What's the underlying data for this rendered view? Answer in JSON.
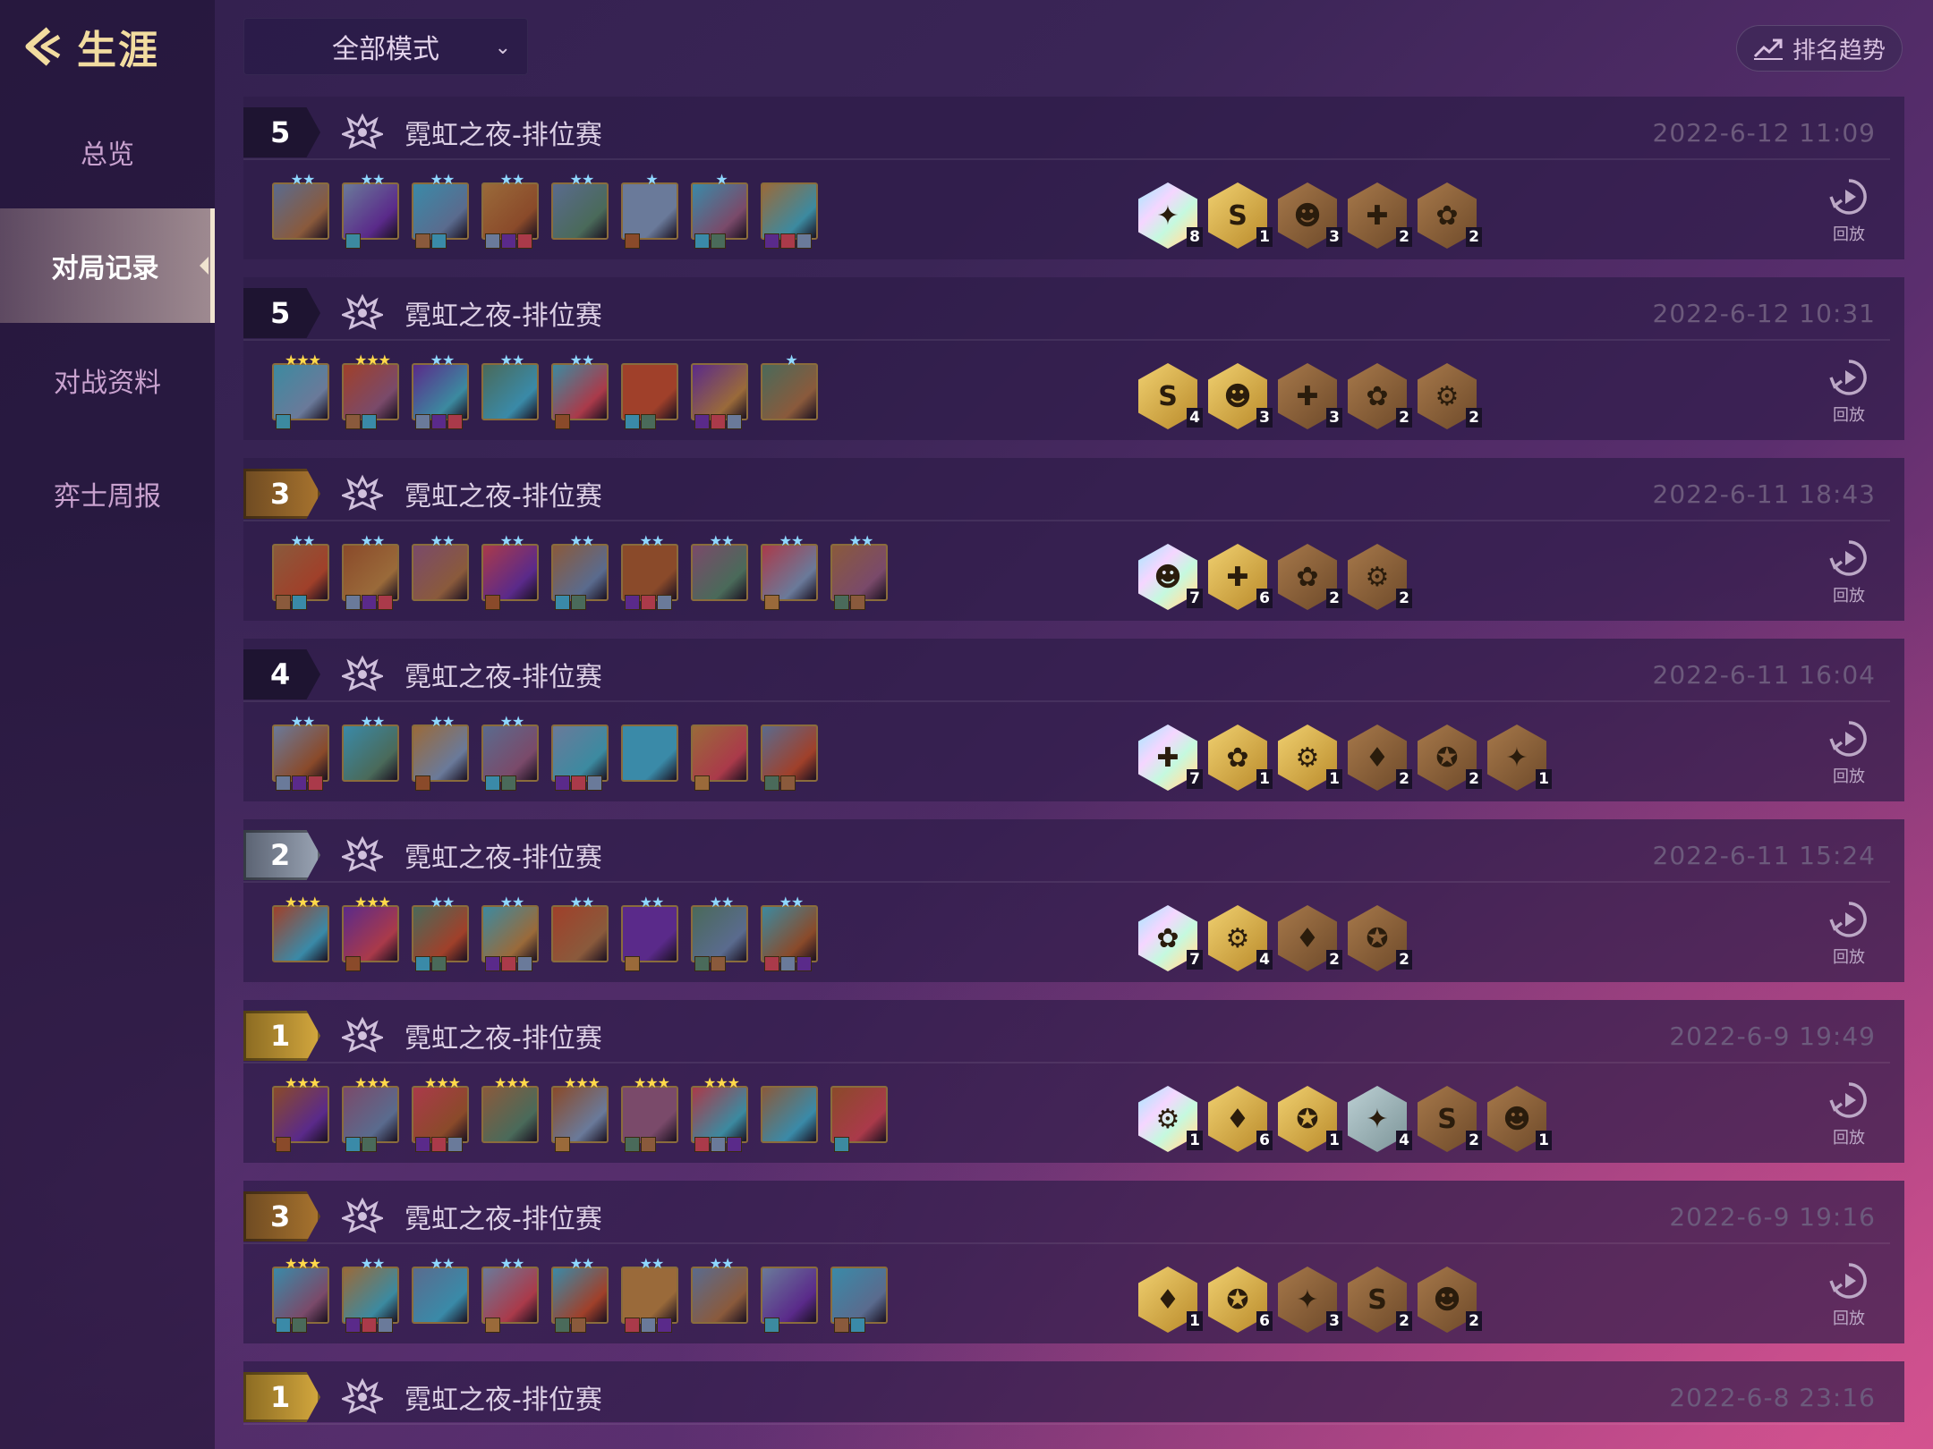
{
  "header": {
    "back_label": "生涯",
    "mode_select": "全部模式",
    "trend_label": "排名趋势"
  },
  "nav": [
    {
      "label": "总览"
    },
    {
      "label": "对局记录"
    },
    {
      "label": "对战资料"
    },
    {
      "label": "弈士周报"
    }
  ],
  "replay_label": "回放",
  "matches": [
    {
      "rank": "5",
      "title": "霓虹之夜-排位赛",
      "date": "2022-6-12 11:09"
    },
    {
      "rank": "5",
      "title": "霓虹之夜-排位赛",
      "date": "2022-6-12 10:31"
    },
    {
      "rank": "3",
      "title": "霓虹之夜-排位赛",
      "date": "2022-6-11 18:43"
    },
    {
      "rank": "4",
      "title": "霓虹之夜-排位赛",
      "date": "2022-6-11 16:04"
    },
    {
      "rank": "2",
      "title": "霓虹之夜-排位赛",
      "date": "2022-6-11 15:24"
    },
    {
      "rank": "1",
      "title": "霓虹之夜-排位赛",
      "date": "2022-6-9 19:49"
    },
    {
      "rank": "3",
      "title": "霓虹之夜-排位赛",
      "date": "2022-6-9 19:16"
    },
    {
      "rank": "1",
      "title": "霓虹之夜-排位赛",
      "date": "2022-6-8 23:16"
    }
  ],
  "trait_counts": [
    [
      "8",
      "1",
      "3",
      "2",
      "2"
    ],
    [
      "4",
      "3",
      "3",
      "2",
      "2"
    ],
    [
      "7",
      "6",
      "2",
      "2"
    ],
    [
      "7",
      "1",
      "1",
      "2",
      "2",
      "1"
    ],
    [
      "7",
      "4",
      "2",
      "2"
    ],
    [
      "1",
      "6",
      "1",
      "4",
      "2",
      "1"
    ],
    [
      "1",
      "6",
      "3",
      "2",
      "2"
    ]
  ],
  "colors": {
    "accent_gold": "#f2dca0",
    "date_text": "#6c5a7c",
    "rank_bronze": "#a8742e",
    "rank_silver": "#9aa4b4",
    "rank_gold": "#d4a83e"
  }
}
